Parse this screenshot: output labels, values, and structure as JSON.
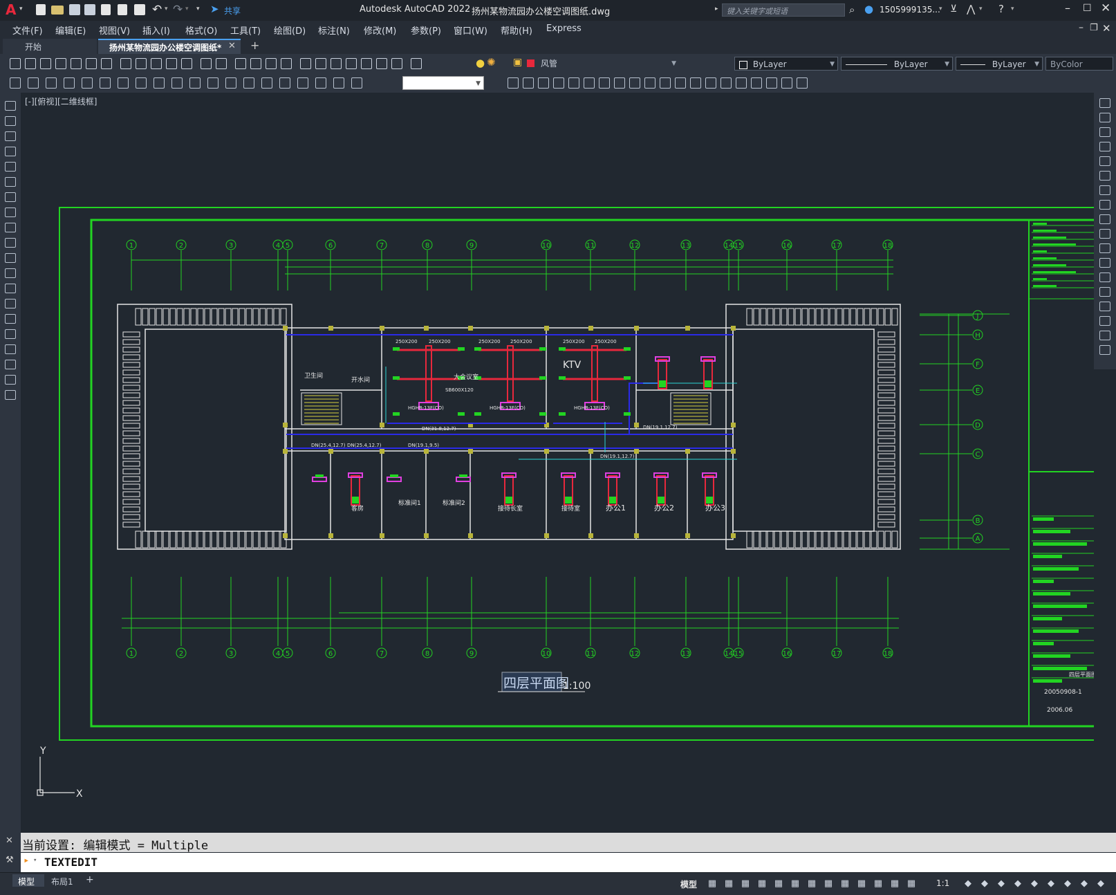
{
  "titlebar": {
    "app_title": "Autodesk AutoCAD 2022",
    "file_title": "扬州某物流园办公楼空调图纸.dwg",
    "share_label": "共享",
    "search_placeholder": "键入关键字或短语",
    "user": "1505999135...",
    "app_letter": "A"
  },
  "menu": [
    "文件(F)",
    "编辑(E)",
    "视图(V)",
    "插入(I)",
    "格式(O)",
    "工具(T)",
    "绘图(D)",
    "标注(N)",
    "修改(M)",
    "参数(P)",
    "窗口(W)",
    "帮助(H)",
    "Express"
  ],
  "tabs": {
    "start": "开始",
    "active": "扬州某物流园办公楼空调图纸*",
    "plus": "+"
  },
  "toolbar": {
    "layer_name": "风管",
    "color_combo": "ByLayer",
    "linetype_combo": "ByLayer",
    "lineweight_combo": "ByLayer",
    "plotstyle_combo": "ByColor",
    "text_style_combo": ""
  },
  "colors": {
    "drawing_green": "#22d422",
    "duct_red": "#e8283c",
    "pipe_blue": "#2a2ae8",
    "cyan": "#2ad6d6",
    "magenta": "#e040e0",
    "yellow_column": "#b8b43a",
    "wall_white": "#e6e6e6",
    "canvas_bg": "#212830"
  },
  "drawing": {
    "viewport_label": "[-][俯视][二维线框]",
    "grid_top": [
      "1",
      "2",
      "3",
      "4",
      "5",
      "6",
      "7",
      "8",
      "9",
      "10",
      "11",
      "12",
      "13",
      "14",
      "15",
      "16",
      "17",
      "18"
    ],
    "grid_right": [
      "J",
      "H",
      "F",
      "E",
      "D",
      "C",
      "B",
      "A"
    ],
    "rooms": {
      "toilet": "卫生间",
      "water_room": "开水间",
      "meeting": "大会议室",
      "ktv": "KTV",
      "guest": "客房",
      "std1": "标准间1",
      "std2": "标准间2",
      "manager": "接待长室",
      "reception": "接待室",
      "office1": "办公1",
      "office2": "办公2",
      "office3": "办公3"
    },
    "duct_sizes": [
      "250X200",
      "250X200",
      "250X200",
      "250X200",
      "250X200",
      "250X200"
    ],
    "fcu_labels": [
      "HGHR-13F(CO)",
      "HGHR-13F(CO)",
      "HGHR-13F(CO)"
    ],
    "diffuser_label": "SB600X120",
    "pipe_labels": [
      "DN(25.4,12.7)",
      "DN(25.4,12.7)",
      "DN(19.1,9.5)",
      "DN(31.8,12.7)",
      "DN(19.1,12.7)",
      "DN(19.1,12.7)"
    ],
    "title": "四层平面图",
    "scale": "1:100",
    "sheet_no": "20050908-1",
    "sheet_date": "2006.06",
    "sheet_name": "四层平面图"
  },
  "ucs": {
    "x": "X",
    "y": "Y"
  },
  "command": {
    "history": "当前设置: 编辑模式 = Multiple",
    "current": "TEXTEDIT"
  },
  "status": {
    "model_tab": "模型",
    "layout_tab": "布局1",
    "model_label": "模型",
    "scale": "1:1"
  }
}
